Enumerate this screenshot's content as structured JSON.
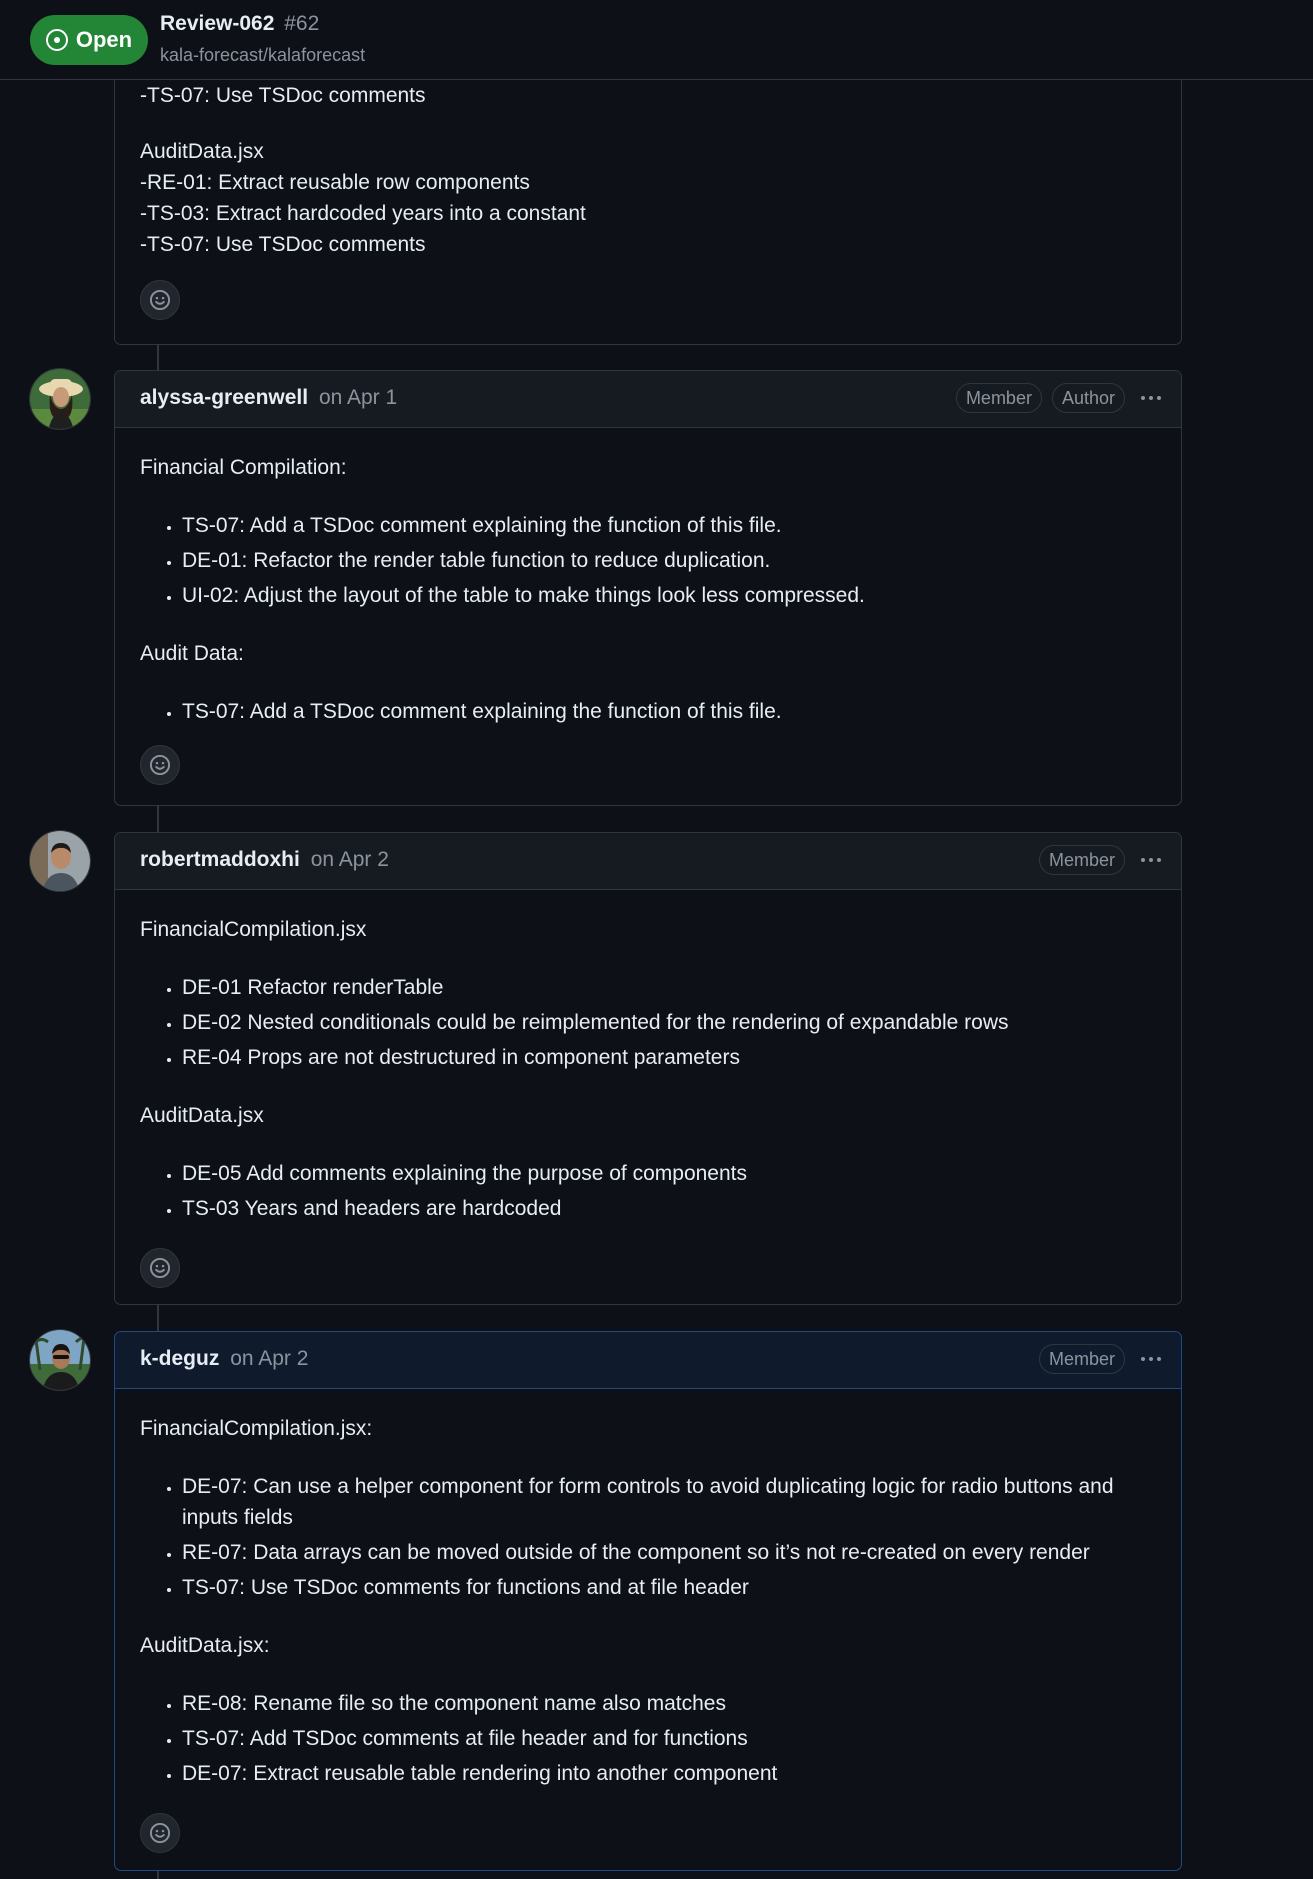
{
  "header": {
    "state": "Open",
    "title": "Review-062",
    "number": "#62",
    "repo": "kala-forecast/kalaforecast"
  },
  "first_comment": {
    "lines_a": [
      "-TS-07: Use TSDoc comments"
    ],
    "file": "AuditData.jsx",
    "lines_b": [
      "-RE-01: Extract reusable row components",
      "-TS-03: Extract hardcoded years into a constant",
      "-TS-07: Use TSDoc comments"
    ]
  },
  "comments": [
    {
      "author": "alyssa-greenwell",
      "date": "on Apr 1",
      "badges": [
        "Member",
        "Author"
      ],
      "sections": [
        {
          "heading": "Financial Compilation:",
          "items": [
            "TS-07: Add a TSDoc comment explaining the function of this file.",
            "DE-01: Refactor the render table function to reduce duplication.",
            "UI-02: Adjust the layout of the table to make things look less compressed."
          ]
        },
        {
          "heading": "Audit Data:",
          "items": [
            "TS-07: Add a TSDoc comment explaining the function of this file."
          ]
        }
      ]
    },
    {
      "author": "robertmaddoxhi",
      "date": "on Apr 2",
      "badges": [
        "Member"
      ],
      "sections": [
        {
          "heading": "FinancialCompilation.jsx",
          "items": [
            "DE-01 Refactor renderTable",
            "DE-02 Nested conditionals could be reimplemented for the rendering of expandable rows",
            "RE-04 Props are not destructured in component parameters"
          ]
        },
        {
          "heading": "AuditData.jsx",
          "items": [
            "DE-05 Add comments explaining the purpose of components",
            "TS-03 Years and headers are hardcoded"
          ]
        }
      ]
    },
    {
      "author": "k-deguz",
      "date": "on Apr 2",
      "badges": [
        "Member"
      ],
      "sections": [
        {
          "heading": "FinancialCompilation.jsx:",
          "items": [
            "DE-07: Can use a helper component for form controls to avoid duplicating logic for radio buttons and inputs fields",
            "RE-07: Data arrays can be moved outside of the component so it’s not re-created on every render",
            "TS-07: Use TSDoc comments for functions and at file header"
          ]
        },
        {
          "heading": "AuditData.jsx:",
          "items": [
            "RE-08: Rename file so the component name also matches",
            "TS-07: Add TSDoc comments at file header and for functions",
            "DE-07: Extract reusable table rendering into another component"
          ]
        }
      ]
    }
  ],
  "icons": {
    "state": "issue-opened-icon",
    "reaction": "smiley-icon",
    "menu": "kebab-horizontal-icon"
  }
}
